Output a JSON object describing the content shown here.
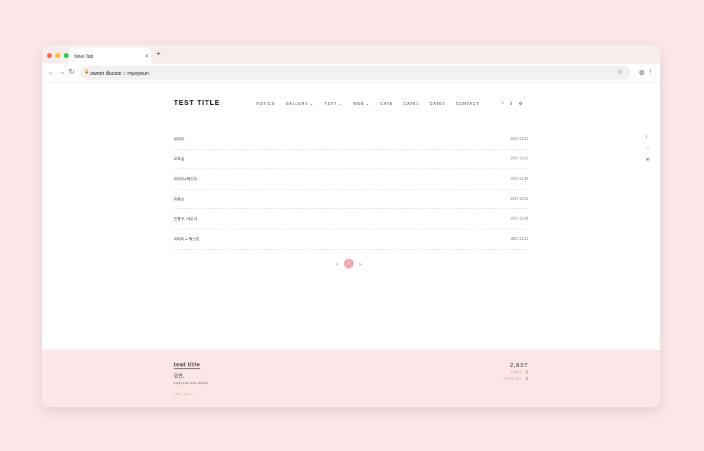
{
  "browser": {
    "tab_title": "New Tab",
    "tab_close": "×",
    "new_tab": "+",
    "url": "sweet illusion :: myoyoun",
    "back": "←",
    "forward": "→",
    "reload": "↻",
    "lock": "🔒",
    "bookmark": "☆",
    "extension": "◍",
    "menu": "⋮"
  },
  "header": {
    "site_title": "TEST TITLE",
    "menu": [
      "NOTICE",
      "GALLERY ⌄",
      "TEXT ⌄",
      "WEB ⌄",
      "CATE",
      "CATE1",
      "CATE2",
      "CONTACT"
    ],
    "icons": {
      "search": "⌕",
      "sort": "⇕",
      "settings": "⚙"
    }
  },
  "share_icons": [
    "f",
    "♡",
    "✉"
  ],
  "posts": [
    {
      "title": "이미지",
      "date": "2017.12.31"
    },
    {
      "title": "보호글",
      "date": "2017.12.31"
    },
    {
      "title": "이미지+텍스트",
      "date": "2017.12.30"
    },
    {
      "title": "유튜브",
      "date": "2017.12.30"
    },
    {
      "title": "인용구, 더보기",
      "date": "2017.12.30"
    },
    {
      "title": "이미지 + 텍스트",
      "date": "2017.11.21"
    }
  ],
  "pagination": {
    "prev": "‹",
    "current": "1",
    "next": "›"
  },
  "footer": {
    "title": "test title",
    "name": "묘연、",
    "desc": "myoyoun test tistory",
    "skin": "skin_ myo ↗",
    "total": "2,837",
    "today_label": "Today",
    "today_value": "2",
    "yesterday_label": "Yesterday",
    "yesterday_value": "2"
  }
}
